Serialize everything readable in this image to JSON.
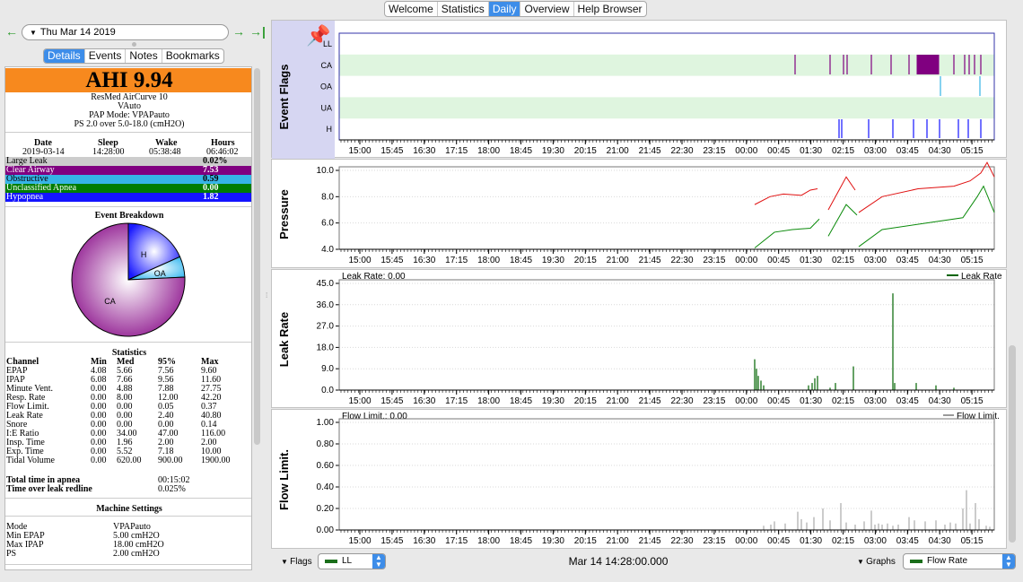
{
  "top_tabs": [
    "Welcome",
    "Statistics",
    "Daily",
    "Overview",
    "Help Browser"
  ],
  "active_top_tab": "Daily",
  "date_field": "Thu Mar 14 2019",
  "sub_tabs": [
    "Details",
    "Events",
    "Notes",
    "Bookmarks"
  ],
  "active_sub_tab": "Details",
  "ahi": "AHI 9.94",
  "machine_lines": [
    "ResMed AirCurve 10",
    "VAuto",
    "PAP Mode: VPAPauto",
    "PS 2.0 over 5.0-18.0 (cmH2O)"
  ],
  "session": {
    "headers": [
      "Date",
      "Sleep",
      "Wake",
      "Hours"
    ],
    "values": [
      "2019-03-14",
      "14:28:00",
      "05:38:48",
      "06:46:02"
    ]
  },
  "events": [
    {
      "name": "Large Leak",
      "value": "0.02%",
      "bg": "#cccccc",
      "fg": "#000000"
    },
    {
      "name": "Clear Airway",
      "value": "7.53",
      "bg": "#800080",
      "fg": "#ffffff"
    },
    {
      "name": "Obstructive",
      "value": "0.59",
      "bg": "#36b4e6",
      "fg": "#000000"
    },
    {
      "name": "Unclassified Apnea",
      "value": "0.00",
      "bg": "#007d00",
      "fg": "#ffffff"
    },
    {
      "name": "Hypopnea",
      "value": "1.82",
      "bg": "#1414ff",
      "fg": "#ffffff"
    }
  ],
  "breakdown": {
    "title": "Event Breakdown",
    "slices": [
      {
        "label": "H",
        "value": 1.82,
        "color": "#1a1aff"
      },
      {
        "label": "OA",
        "value": 0.59,
        "color": "#3cbaf0"
      },
      {
        "label": "CA",
        "value": 7.53,
        "color": "#8a0f8a"
      }
    ]
  },
  "stats": {
    "title": "Statistics",
    "headers": [
      "Channel",
      "Min",
      "Med",
      "95%",
      "Max"
    ],
    "rows": [
      [
        "EPAP",
        "4.08",
        "5.66",
        "7.56",
        "9.60"
      ],
      [
        "IPAP",
        "6.08",
        "7.66",
        "9.56",
        "11.60"
      ],
      [
        "Minute Vent.",
        "0.00",
        "4.88",
        "7.88",
        "27.75"
      ],
      [
        "Resp. Rate",
        "0.00",
        "8.00",
        "12.00",
        "42.20"
      ],
      [
        "Flow Limit.",
        "0.00",
        "0.00",
        "0.05",
        "0.37"
      ],
      [
        "Leak Rate",
        "0.00",
        "0.00",
        "2.40",
        "40.80"
      ],
      [
        "Snore",
        "0.00",
        "0.00",
        "0.00",
        "0.14"
      ],
      [
        "I:E Ratio",
        "0.00",
        "34.00",
        "47.00",
        "116.00"
      ],
      [
        "Insp. Time",
        "0.00",
        "1.96",
        "2.00",
        "2.00"
      ],
      [
        "Exp. Time",
        "0.00",
        "5.52",
        "7.18",
        "10.00"
      ],
      [
        "Tidal Volume",
        "0.00",
        "620.00",
        "900.00",
        "1900.00"
      ]
    ]
  },
  "totals": [
    {
      "label": "Total time in apnea",
      "value": "00:15:02"
    },
    {
      "label": "Time over leak redline",
      "value": "0.025%"
    }
  ],
  "machine_settings": {
    "title": "Machine Settings",
    "rows": [
      [
        "Mode",
        "VPAPauto"
      ],
      [
        "Min EPAP",
        "5.00 cmH2O"
      ],
      [
        "Max IPAP",
        "18.00 cmH2O"
      ],
      [
        "PS",
        "2.00 cmH2O"
      ]
    ]
  },
  "time_ticks": [
    "15:00",
    "15:45",
    "16:30",
    "17:15",
    "18:00",
    "18:45",
    "19:30",
    "20:15",
    "21:00",
    "21:45",
    "22:30",
    "23:15",
    "00:00",
    "00:45",
    "01:30",
    "02:15",
    "03:00",
    "03:45",
    "04:30",
    "05:15"
  ],
  "graphs": {
    "flags": {
      "title": "Event Flags",
      "rows": [
        "LL",
        "CA",
        "OA",
        "UA",
        "H"
      ]
    },
    "pressure": {
      "title": "Pressure",
      "yticks": [
        "10.0",
        "8.0",
        "6.0",
        "4.0"
      ]
    },
    "leak": {
      "title": "Leak Rate",
      "header": "Leak Rate: 0.00",
      "legend": "Leak Rate",
      "yticks": [
        "45.0",
        "36.0",
        "27.0",
        "18.0",
        "9.0",
        "0.0"
      ]
    },
    "flow": {
      "title": "Flow Limit.",
      "header": "Flow Limit.: 0.00",
      "legend": "Flow Limit.",
      "yticks": [
        "1.00",
        "0.80",
        "0.60",
        "0.40",
        "0.20",
        "0.00"
      ]
    }
  },
  "bottom": {
    "flags_label": "Flags",
    "flags_value": "LL",
    "timestamp": "Mar 14 14:28:00.000",
    "graphs_label": "Graphs",
    "graphs_value": "Flow Rate"
  },
  "colors": {
    "accent": "#3d8de9",
    "ahi_bg": "#f7891e",
    "epap": "#0a8a0a",
    "ipap": "#e01010",
    "leak": "#006400",
    "flow": "#9a9a9a",
    "flag_band": "#dff5df"
  }
}
